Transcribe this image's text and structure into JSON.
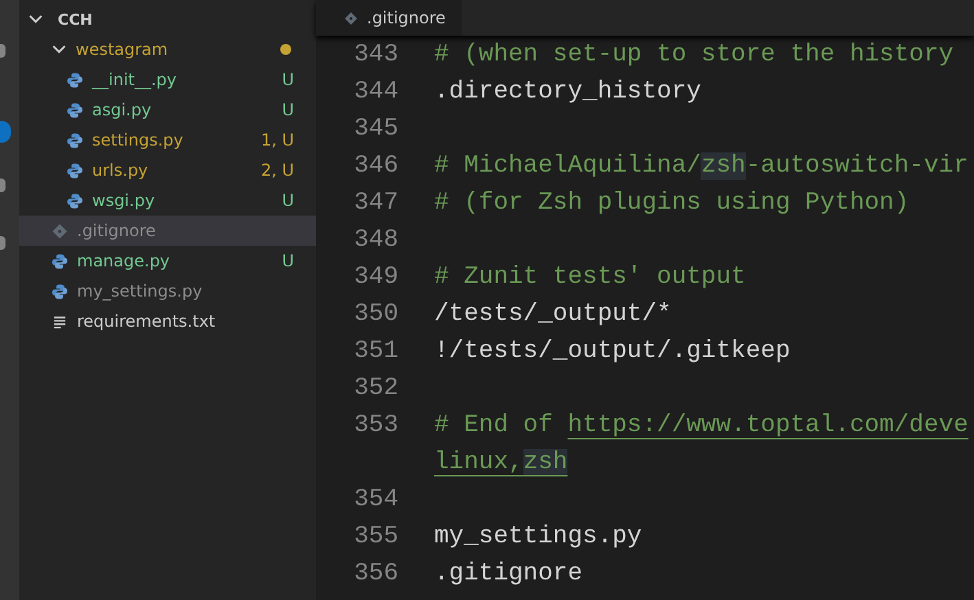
{
  "explorer": {
    "root": {
      "label": "CCH",
      "expanded": true,
      "children": [
        {
          "label": "westagram",
          "kind": "folder",
          "expanded": true,
          "color": "#c5a332",
          "has_changes": true,
          "selected": false,
          "children": [
            {
              "label": "__init__.py",
              "kind": "python",
              "status": "U",
              "color": "#73c991",
              "selected": false
            },
            {
              "label": "asgi.py",
              "kind": "python",
              "status": "U",
              "color": "#73c991",
              "selected": false
            },
            {
              "label": "settings.py",
              "kind": "python",
              "status": "1, U",
              "color": "#c5a332",
              "selected": false
            },
            {
              "label": "urls.py",
              "kind": "python",
              "status": "2, U",
              "color": "#c5a332",
              "selected": false
            },
            {
              "label": "wsgi.py",
              "kind": "python",
              "status": "U",
              "color": "#73c991",
              "selected": false
            }
          ]
        },
        {
          "label": ".gitignore",
          "kind": "git",
          "color": "#8c8c8c",
          "selected": true
        },
        {
          "label": "manage.py",
          "kind": "python",
          "status": "U",
          "color": "#73c991",
          "selected": false
        },
        {
          "label": "my_settings.py",
          "kind": "python",
          "color": "#8c8c8c",
          "selected": false
        },
        {
          "label": "requirements.txt",
          "kind": "text",
          "color": "#cccccc",
          "selected": false
        }
      ]
    }
  },
  "editor": {
    "tab": {
      "label": ".gitignore"
    },
    "lines": [
      {
        "number": "343",
        "kind": "comment",
        "segments": [
          {
            "text": "# (when set-up to store the history"
          }
        ]
      },
      {
        "number": "344",
        "kind": "plain",
        "segments": [
          {
            "text": ".directory_history"
          }
        ]
      },
      {
        "number": "345"
      },
      {
        "number": "346",
        "kind": "comment",
        "segments": [
          {
            "text": "# MichaelAquilina/"
          },
          {
            "text": "zsh",
            "highlight": true
          },
          {
            "text": "-autoswitch-vir"
          }
        ]
      },
      {
        "number": "347",
        "kind": "comment",
        "segments": [
          {
            "text": "# (for Zsh plugins using Python)"
          }
        ]
      },
      {
        "number": "348"
      },
      {
        "number": "349",
        "kind": "comment",
        "segments": [
          {
            "text": "# Zunit tests' output"
          }
        ]
      },
      {
        "number": "350",
        "kind": "plain",
        "segments": [
          {
            "text": "/tests/_output/*"
          }
        ]
      },
      {
        "number": "351",
        "kind": "plain",
        "segments": [
          {
            "text": "!/tests/_output/.gitkeep"
          }
        ]
      },
      {
        "number": "352"
      },
      {
        "number": "353",
        "kind": "comment",
        "segments": [
          {
            "text": "# End of "
          },
          {
            "text": "https://www.toptal.com/deve",
            "link": true
          }
        ]
      },
      {
        "kind": "comment",
        "segments": [
          {
            "text": "linux,",
            "link": true
          },
          {
            "text": "zsh",
            "link": true,
            "highlight": true
          }
        ]
      },
      {
        "number": "354"
      },
      {
        "number": "355",
        "kind": "plain",
        "segments": [
          {
            "text": "my_settings.py"
          }
        ]
      },
      {
        "number": "356",
        "kind": "plain",
        "segments": [
          {
            "text": ".gitignore"
          }
        ]
      }
    ]
  }
}
